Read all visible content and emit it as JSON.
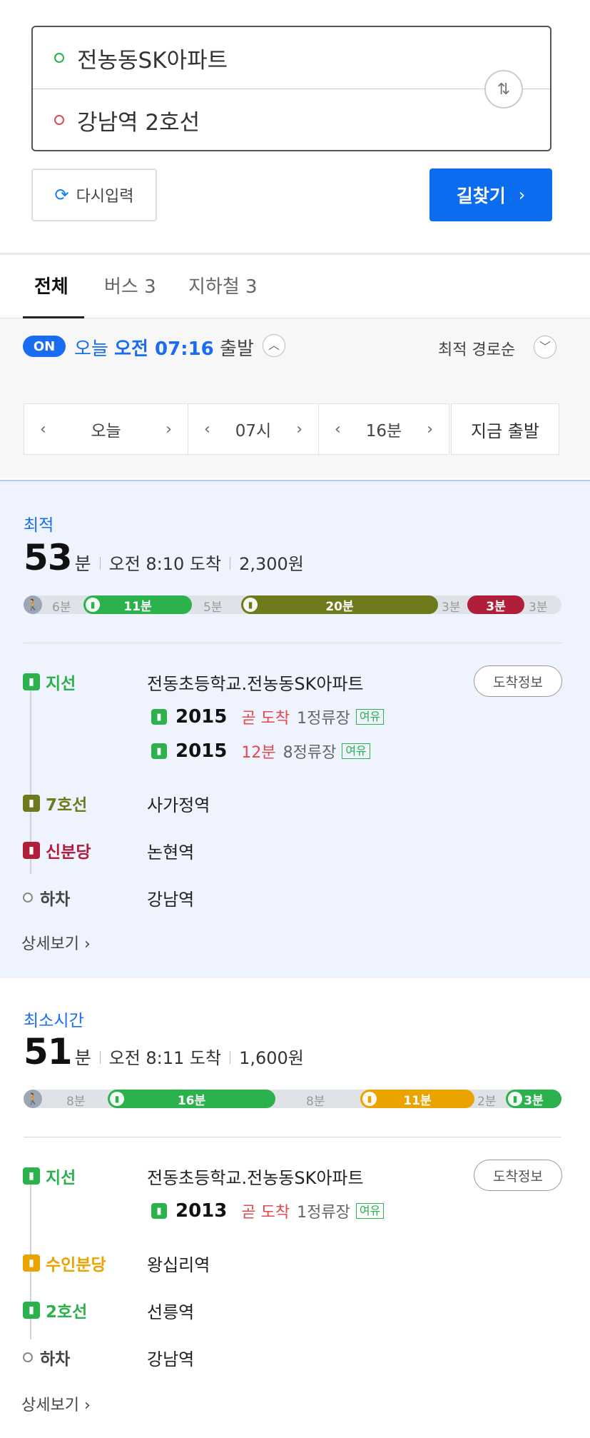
{
  "search": {
    "origin": "전농동SK아파트",
    "destination": "강남역 2호선",
    "swap_icon": "⇅"
  },
  "actions": {
    "reset_label": "다시입력",
    "find_label": "길찾기",
    "find_chev": "›"
  },
  "tabs": [
    {
      "label": "전체"
    },
    {
      "label": "버스 3"
    },
    {
      "label": "지하철 3"
    }
  ],
  "departure": {
    "on_badge": "ON",
    "prefix": "오늘",
    "time_bold": "오전 07:16",
    "suffix": "출발",
    "sort_label": "최적 경로순"
  },
  "time_selector": {
    "day": "오늘",
    "hour": "07시",
    "minute": "16분",
    "now_label": "지금 출발",
    "prev": "‹",
    "next": "›"
  },
  "routes": [
    {
      "label": "최적",
      "minutes": "53",
      "unit": "분",
      "arrival": "오전 8:10 도착",
      "fare": "2,300원",
      "segments": [
        {
          "type": "walk",
          "text": "6분"
        },
        {
          "type": "bus",
          "color": "#2bb24c",
          "text": "11분"
        },
        {
          "type": "walk",
          "text": "5분"
        },
        {
          "type": "subway",
          "color": "#6e7a1b",
          "text": "20분"
        },
        {
          "type": "walk",
          "text": "3분"
        },
        {
          "type": "subway",
          "color": "#b01f3a",
          "text": "3분"
        },
        {
          "type": "walk",
          "text": "3분"
        }
      ],
      "steps": [
        {
          "name": "지선",
          "color": "#2bb24c",
          "stop": "전동초등학교.전농동SK아파트"
        },
        {
          "name": "7호선",
          "color": "#6e7a1b",
          "stop": "사가정역"
        },
        {
          "name": "신분당",
          "color": "#b01f3a",
          "stop": "논현역"
        },
        {
          "name": "하차",
          "color": "#888888",
          "stop": "강남역"
        }
      ],
      "arrival_info_label": "도착정보",
      "buses": [
        {
          "number": "2015",
          "when": "곧 도착",
          "stops": "1정류장",
          "crowd": "여유"
        },
        {
          "number": "2015",
          "when": "12분",
          "stops": "8정류장",
          "crowd": "여유"
        }
      ],
      "detail_label": "상세보기 ›"
    },
    {
      "label": "최소시간",
      "minutes": "51",
      "unit": "분",
      "arrival": "오전 8:11 도착",
      "fare": "1,600원",
      "segments": [
        {
          "type": "walk",
          "text": "8분"
        },
        {
          "type": "bus",
          "color": "#2bb24c",
          "text": "16분"
        },
        {
          "type": "walk",
          "text": "8분"
        },
        {
          "type": "subway",
          "color": "#eba300",
          "text": "11분"
        },
        {
          "type": "walk",
          "text": "2분"
        },
        {
          "type": "subway",
          "color": "#2bb24c",
          "text": "3분"
        }
      ],
      "steps": [
        {
          "name": "지선",
          "color": "#2bb24c",
          "stop": "전동초등학교.전농동SK아파트"
        },
        {
          "name": "수인분당",
          "color": "#eba300",
          "stop": "왕십리역"
        },
        {
          "name": "2호선",
          "color": "#2bb24c",
          "stop": "선릉역"
        },
        {
          "name": "하차",
          "color": "#888888",
          "stop": "강남역"
        }
      ],
      "arrival_info_label": "도착정보",
      "buses": [
        {
          "number": "2013",
          "when": "곧 도착",
          "stops": "1정류장",
          "crowd": "여유"
        }
      ],
      "detail_label": "상세보기 ›"
    }
  ]
}
